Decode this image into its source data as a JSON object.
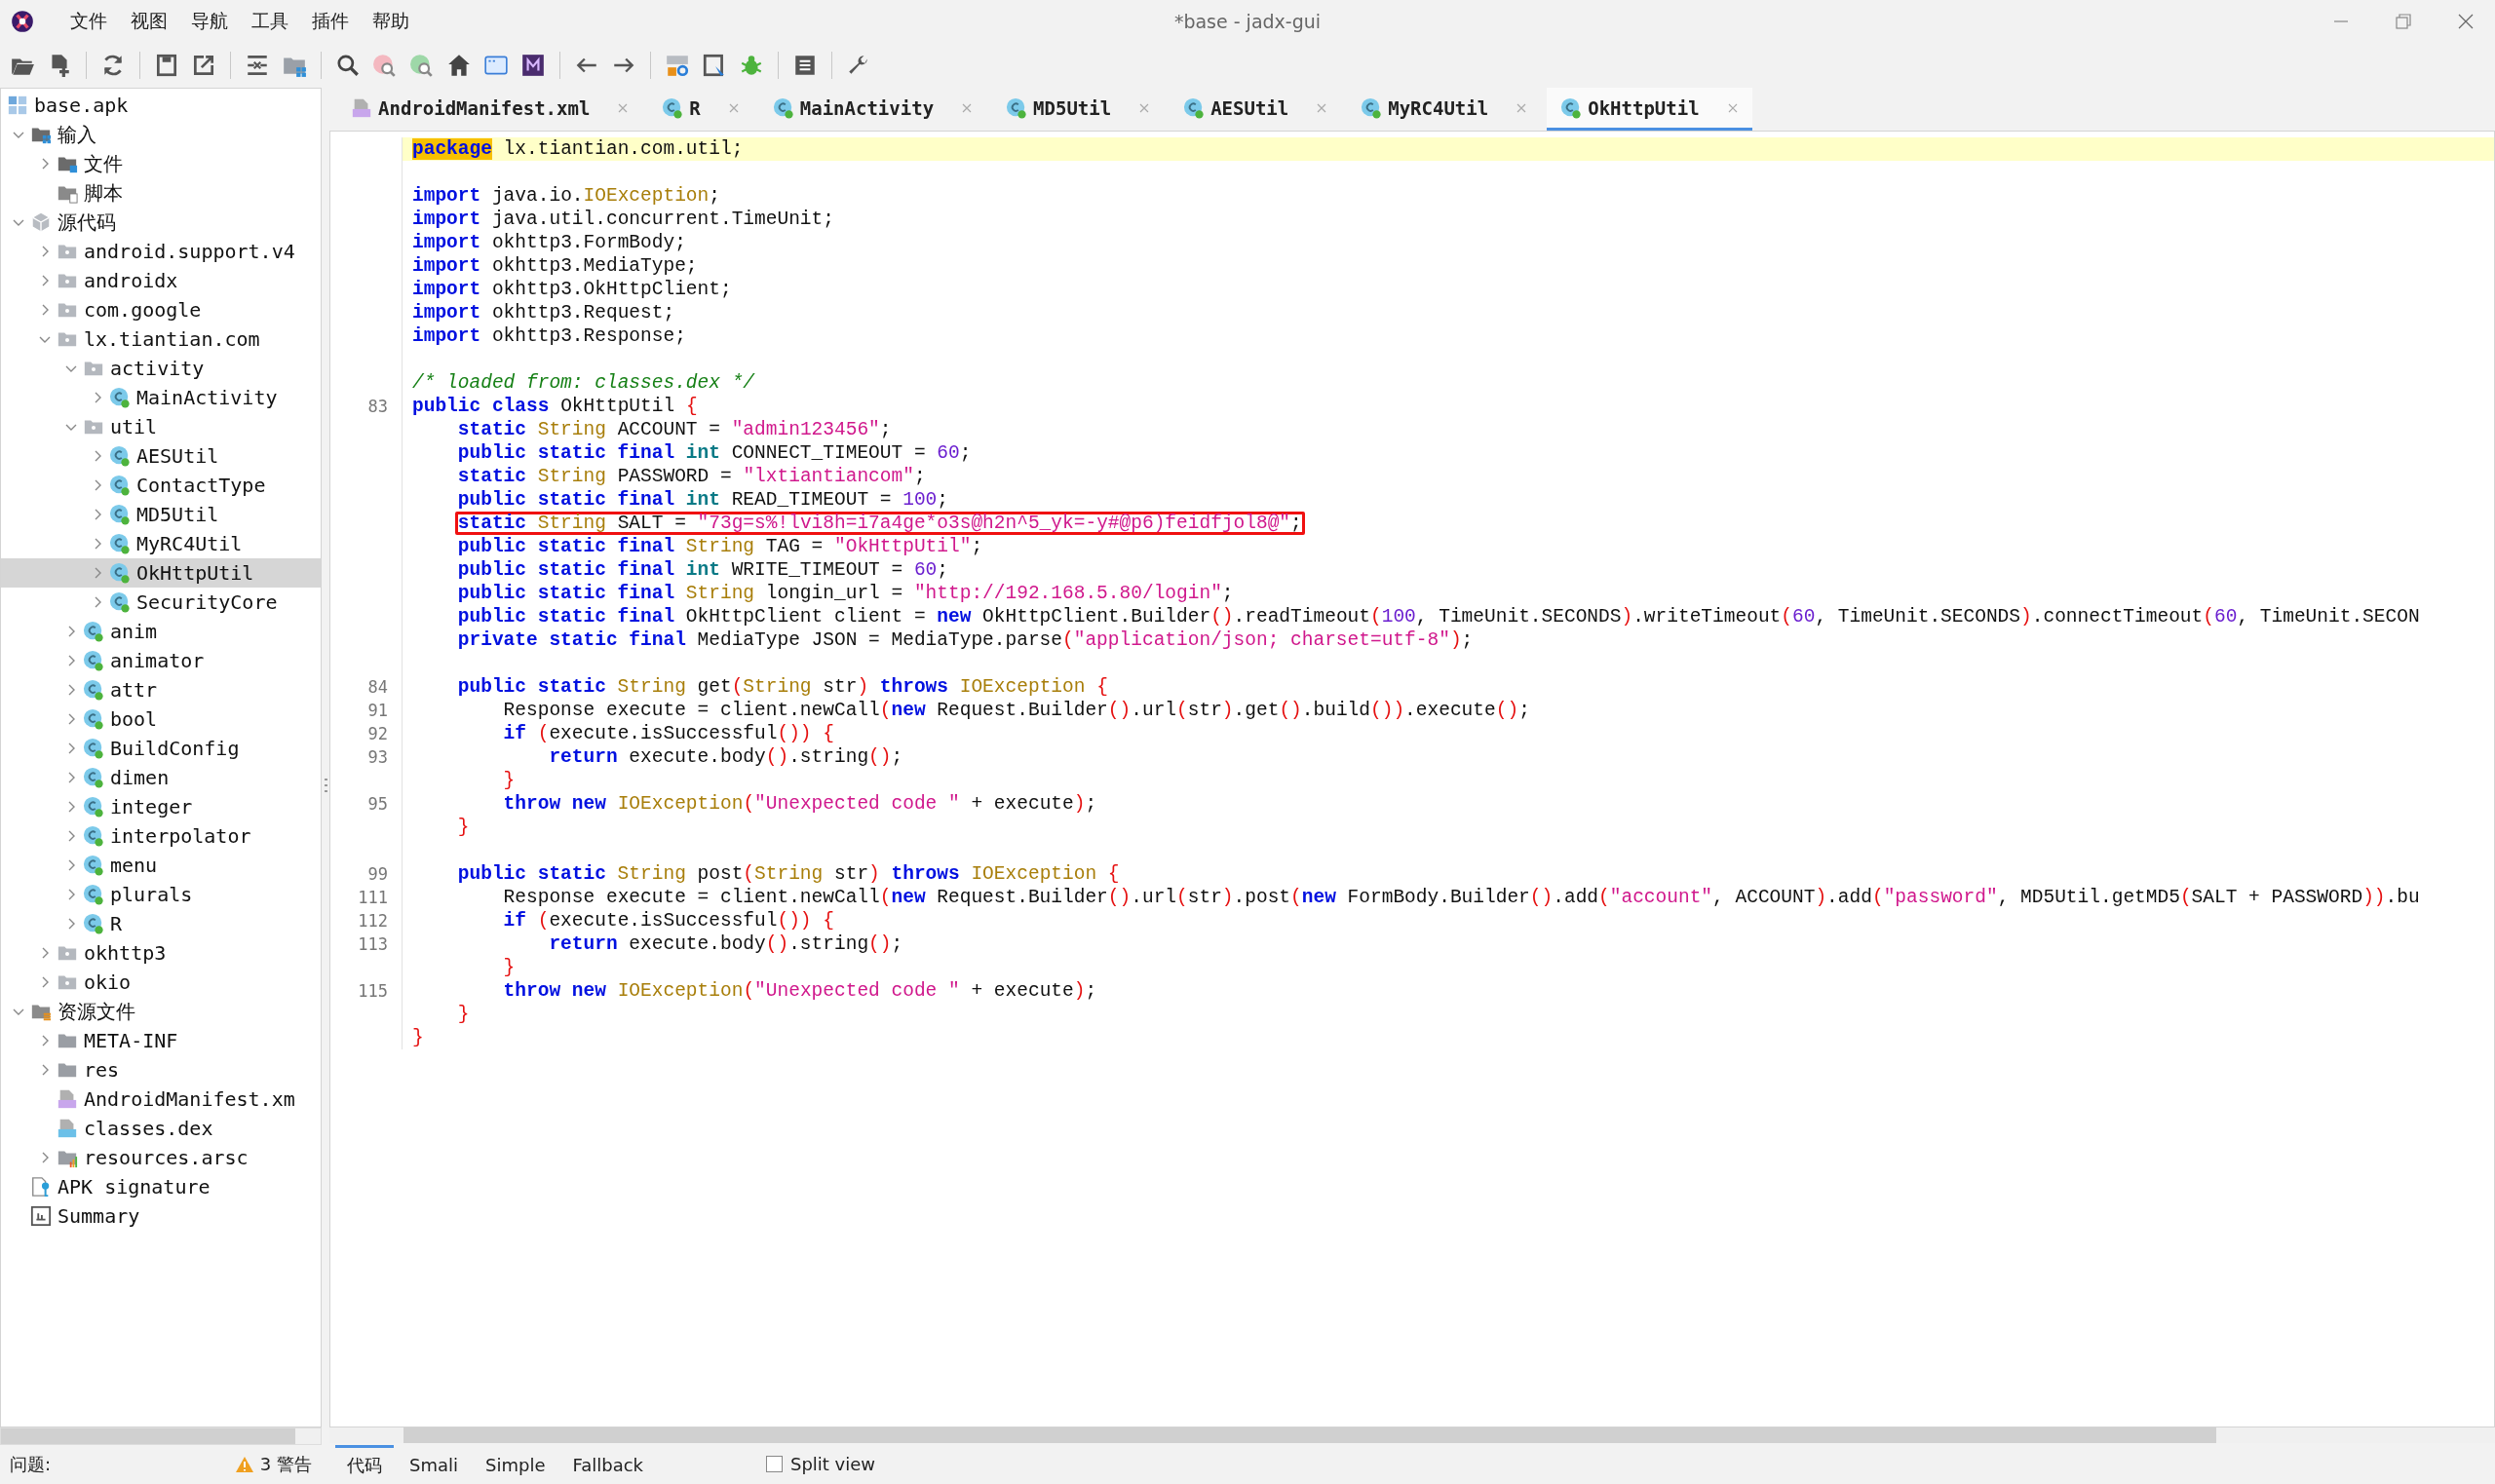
{
  "window": {
    "title": "*base - jadx-gui"
  },
  "menu": [
    "文件",
    "视图",
    "导航",
    "工具",
    "插件",
    "帮助"
  ],
  "tree": {
    "label": "base.apk",
    "kind": "apk",
    "selected": false,
    "children": [
      {
        "label": "输入",
        "kind": "input",
        "expanded": true,
        "selected": false,
        "children": [
          {
            "label": "文件",
            "kind": "files",
            "expanded": false,
            "selected": false
          },
          {
            "label": "脚本",
            "kind": "scripts",
            "selected": false
          }
        ]
      },
      {
        "label": "源代码",
        "kind": "source",
        "expanded": true,
        "selected": false,
        "children": [
          {
            "label": "android.support.v4",
            "kind": "package",
            "expanded": false,
            "selected": false
          },
          {
            "label": "androidx",
            "kind": "package",
            "expanded": false,
            "selected": false
          },
          {
            "label": "com.google",
            "kind": "package",
            "expanded": false,
            "selected": false
          },
          {
            "label": "lx.tiantian.com",
            "kind": "package",
            "expanded": true,
            "selected": false,
            "children": [
              {
                "label": "activity",
                "kind": "package",
                "expanded": true,
                "selected": false,
                "children": [
                  {
                    "label": "MainActivity",
                    "kind": "class",
                    "expanded": false,
                    "selected": false
                  }
                ]
              },
              {
                "label": "util",
                "kind": "package",
                "expanded": true,
                "selected": false,
                "children": [
                  {
                    "label": "AESUtil",
                    "kind": "class",
                    "expanded": false,
                    "selected": false
                  },
                  {
                    "label": "ContactType",
                    "kind": "class",
                    "expanded": false,
                    "selected": false
                  },
                  {
                    "label": "MD5Util",
                    "kind": "class",
                    "expanded": false,
                    "selected": false
                  },
                  {
                    "label": "MyRC4Util",
                    "kind": "class",
                    "expanded": false,
                    "selected": false
                  },
                  {
                    "label": "OkHttpUtil",
                    "kind": "class",
                    "expanded": false,
                    "selected": true
                  },
                  {
                    "label": "SecurityCore",
                    "kind": "class",
                    "expanded": false,
                    "selected": false
                  }
                ]
              },
              {
                "label": "anim",
                "kind": "class",
                "expanded": false,
                "selected": false
              },
              {
                "label": "animator",
                "kind": "class",
                "expanded": false,
                "selected": false
              },
              {
                "label": "attr",
                "kind": "class",
                "expanded": false,
                "selected": false
              },
              {
                "label": "bool",
                "kind": "class",
                "expanded": false,
                "selected": false
              },
              {
                "label": "BuildConfig",
                "kind": "class",
                "expanded": false,
                "selected": false
              },
              {
                "label": "dimen",
                "kind": "class",
                "expanded": false,
                "selected": false
              },
              {
                "label": "integer",
                "kind": "class",
                "expanded": false,
                "selected": false
              },
              {
                "label": "interpolator",
                "kind": "class",
                "expanded": false,
                "selected": false
              },
              {
                "label": "menu",
                "kind": "class",
                "expanded": false,
                "selected": false
              },
              {
                "label": "plurals",
                "kind": "class",
                "expanded": false,
                "selected": false
              },
              {
                "label": "R",
                "kind": "class",
                "expanded": false,
                "selected": false
              }
            ]
          },
          {
            "label": "okhttp3",
            "kind": "package",
            "expanded": false,
            "selected": false
          },
          {
            "label": "okio",
            "kind": "package",
            "expanded": false,
            "selected": false
          }
        ]
      },
      {
        "label": "资源文件",
        "kind": "resources",
        "expanded": true,
        "selected": false,
        "children": [
          {
            "label": "META-INF",
            "kind": "folder",
            "expanded": false,
            "selected": false
          },
          {
            "label": "res",
            "kind": "folder",
            "expanded": false,
            "selected": false
          },
          {
            "label": "AndroidManifest.xm",
            "kind": "manifest",
            "selected": false
          },
          {
            "label": "classes.dex",
            "kind": "dex",
            "selected": false
          },
          {
            "label": "resources.arsc",
            "kind": "arsc",
            "expanded": false,
            "selected": false
          }
        ]
      },
      {
        "label": "APK signature",
        "kind": "signature",
        "selected": false
      },
      {
        "label": "Summary",
        "kind": "summary",
        "selected": false
      }
    ]
  },
  "tabs": [
    {
      "label": "AndroidManifest.xml",
      "kind": "manifest",
      "selected": false
    },
    {
      "label": "R",
      "kind": "class",
      "selected": false
    },
    {
      "label": "MainActivity",
      "kind": "class",
      "selected": false
    },
    {
      "label": "MD5Util",
      "kind": "class",
      "selected": false
    },
    {
      "label": "AESUtil",
      "kind": "class",
      "selected": false
    },
    {
      "label": "MyRC4Util",
      "kind": "class",
      "selected": false
    },
    {
      "label": "OkHttpUtil",
      "kind": "class",
      "selected": true
    }
  ],
  "code": [
    {
      "kind": "code",
      "current": true,
      "boxed": false,
      "tokens": [
        {
          "kind": "match",
          "text": "package"
        },
        {
          "kind": "plain",
          "text": " lx.tiantian.com.util;"
        }
      ]
    },
    {
      "kind": "blank"
    },
    {
      "kind": "code",
      "current": false,
      "boxed": false,
      "tokens": [
        {
          "kind": "keyword",
          "text": "import"
        },
        {
          "kind": "plain",
          "text": " java.io."
        },
        {
          "kind": "type",
          "text": "IOException"
        },
        {
          "kind": "plain",
          "text": ";"
        }
      ]
    },
    {
      "kind": "code",
      "current": false,
      "boxed": false,
      "tokens": [
        {
          "kind": "keyword",
          "text": "import"
        },
        {
          "kind": "plain",
          "text": " java.util.concurrent.TimeUnit;"
        }
      ]
    },
    {
      "kind": "code",
      "current": false,
      "boxed": false,
      "tokens": [
        {
          "kind": "keyword",
          "text": "import"
        },
        {
          "kind": "plain",
          "text": " okhttp3.FormBody;"
        }
      ]
    },
    {
      "kind": "code",
      "current": false,
      "boxed": false,
      "tokens": [
        {
          "kind": "keyword",
          "text": "import"
        },
        {
          "kind": "plain",
          "text": " okhttp3.MediaType;"
        }
      ]
    },
    {
      "kind": "code",
      "current": false,
      "boxed": false,
      "tokens": [
        {
          "kind": "keyword",
          "text": "import"
        },
        {
          "kind": "plain",
          "text": " okhttp3.OkHttpClient;"
        }
      ]
    },
    {
      "kind": "code",
      "current": false,
      "boxed": false,
      "tokens": [
        {
          "kind": "keyword",
          "text": "import"
        },
        {
          "kind": "plain",
          "text": " okhttp3.Request;"
        }
      ]
    },
    {
      "kind": "code",
      "current": false,
      "boxed": false,
      "tokens": [
        {
          "kind": "keyword",
          "text": "import"
        },
        {
          "kind": "plain",
          "text": " okhttp3.Response;"
        }
      ]
    },
    {
      "kind": "blank"
    },
    {
      "kind": "code",
      "current": false,
      "boxed": false,
      "tokens": [
        {
          "kind": "comment",
          "text": "/* loaded from: classes.dex */"
        }
      ]
    },
    {
      "kind": "code",
      "num": "83",
      "current": false,
      "boxed": false,
      "tokens": [
        {
          "kind": "keyword",
          "text": "public class"
        },
        {
          "kind": "plain",
          "text": " OkHttpUtil "
        },
        {
          "kind": "bracket",
          "text": "{"
        }
      ]
    },
    {
      "kind": "code",
      "current": false,
      "boxed": false,
      "tokens": [
        {
          "kind": "keyword",
          "text": "    static"
        },
        {
          "kind": "type",
          "text": " String"
        },
        {
          "kind": "plain",
          "text": " ACCOUNT = "
        },
        {
          "kind": "string",
          "text": "\"admin123456\""
        },
        {
          "kind": "plain",
          "text": ";"
        }
      ]
    },
    {
      "kind": "code",
      "current": false,
      "boxed": false,
      "tokens": [
        {
          "kind": "keyword",
          "text": "    public static final"
        },
        {
          "kind": "primitive",
          "text": " int"
        },
        {
          "kind": "plain",
          "text": " CONNECT_TIMEOUT = "
        },
        {
          "kind": "number",
          "text": "60"
        },
        {
          "kind": "plain",
          "text": ";"
        }
      ]
    },
    {
      "kind": "code",
      "current": false,
      "boxed": false,
      "tokens": [
        {
          "kind": "keyword",
          "text": "    static"
        },
        {
          "kind": "type",
          "text": " String"
        },
        {
          "kind": "plain",
          "text": " PASSWORD = "
        },
        {
          "kind": "string",
          "text": "\"lxtiantiancom\""
        },
        {
          "kind": "plain",
          "text": ";"
        }
      ]
    },
    {
      "kind": "code",
      "current": false,
      "boxed": false,
      "tokens": [
        {
          "kind": "keyword",
          "text": "    public static final"
        },
        {
          "kind": "primitive",
          "text": " int"
        },
        {
          "kind": "plain",
          "text": " READ_TIMEOUT = "
        },
        {
          "kind": "number",
          "text": "100"
        },
        {
          "kind": "plain",
          "text": ";"
        }
      ]
    },
    {
      "kind": "code",
      "current": false,
      "boxed": true,
      "tokens": [
        {
          "kind": "keyword",
          "text": "    static"
        },
        {
          "kind": "type",
          "text": " String"
        },
        {
          "kind": "plain",
          "text": " SALT = "
        },
        {
          "kind": "string",
          "text": "\"73g=s%!lvi8h=i7a4ge*o3s@h2n^5_yk=-y#@p6)feidfjol8@\""
        },
        {
          "kind": "plain",
          "text": ";"
        }
      ]
    },
    {
      "kind": "code",
      "current": false,
      "boxed": false,
      "tokens": [
        {
          "kind": "keyword",
          "text": "    public static final"
        },
        {
          "kind": "type",
          "text": " String"
        },
        {
          "kind": "plain",
          "text": " TAG = "
        },
        {
          "kind": "string",
          "text": "\"OkHttpUtil\""
        },
        {
          "kind": "plain",
          "text": ";"
        }
      ]
    },
    {
      "kind": "code",
      "current": false,
      "boxed": false,
      "tokens": [
        {
          "kind": "keyword",
          "text": "    public static final"
        },
        {
          "kind": "primitive",
          "text": " int"
        },
        {
          "kind": "plain",
          "text": " WRITE_TIMEOUT = "
        },
        {
          "kind": "number",
          "text": "60"
        },
        {
          "kind": "plain",
          "text": ";"
        }
      ]
    },
    {
      "kind": "code",
      "current": false,
      "boxed": false,
      "tokens": [
        {
          "kind": "keyword",
          "text": "    public static final"
        },
        {
          "kind": "type",
          "text": " String"
        },
        {
          "kind": "plain",
          "text": " longin_url = "
        },
        {
          "kind": "string",
          "text": "\"http://192.168.5.80/login\""
        },
        {
          "kind": "plain",
          "text": ";"
        }
      ]
    },
    {
      "kind": "code",
      "current": false,
      "boxed": false,
      "tokens": [
        {
          "kind": "keyword",
          "text": "    public static final"
        },
        {
          "kind": "plain",
          "text": " OkHttpClient client = "
        },
        {
          "kind": "keyword",
          "text": "new"
        },
        {
          "kind": "plain",
          "text": " OkHttpClient.Builder"
        },
        {
          "kind": "bracket",
          "text": "()"
        },
        {
          "kind": "plain",
          "text": ".readTimeout"
        },
        {
          "kind": "bracket",
          "text": "("
        },
        {
          "kind": "number",
          "text": "100"
        },
        {
          "kind": "plain",
          "text": ", TimeUnit.SECONDS"
        },
        {
          "kind": "bracket",
          "text": ")"
        },
        {
          "kind": "plain",
          "text": ".writeTimeout"
        },
        {
          "kind": "bracket",
          "text": "("
        },
        {
          "kind": "number",
          "text": "60"
        },
        {
          "kind": "plain",
          "text": ", TimeUnit.SECONDS"
        },
        {
          "kind": "bracket",
          "text": ")"
        },
        {
          "kind": "plain",
          "text": ".connectTimeout"
        },
        {
          "kind": "bracket",
          "text": "("
        },
        {
          "kind": "number",
          "text": "60"
        },
        {
          "kind": "plain",
          "text": ", TimeUnit.SECON"
        }
      ]
    },
    {
      "kind": "code",
      "current": false,
      "boxed": false,
      "tokens": [
        {
          "kind": "keyword",
          "text": "    private static final"
        },
        {
          "kind": "plain",
          "text": " MediaType JSON = MediaType.parse"
        },
        {
          "kind": "bracket",
          "text": "("
        },
        {
          "kind": "string",
          "text": "\"application/json; charset=utf-8\""
        },
        {
          "kind": "bracket",
          "text": ")"
        },
        {
          "kind": "plain",
          "text": ";"
        }
      ]
    },
    {
      "kind": "blank"
    },
    {
      "kind": "code",
      "num": "84",
      "current": false,
      "boxed": false,
      "tokens": [
        {
          "kind": "keyword",
          "text": "    public static"
        },
        {
          "kind": "type",
          "text": " String"
        },
        {
          "kind": "plain",
          "text": " get"
        },
        {
          "kind": "bracket",
          "text": "("
        },
        {
          "kind": "type",
          "text": "String"
        },
        {
          "kind": "plain",
          "text": " str"
        },
        {
          "kind": "bracket",
          "text": ")"
        },
        {
          "kind": "keyword",
          "text": " throws"
        },
        {
          "kind": "type",
          "text": " IOException"
        },
        {
          "kind": "bracket",
          "text": " {"
        }
      ]
    },
    {
      "kind": "code",
      "num": "91",
      "current": false,
      "boxed": false,
      "tokens": [
        {
          "kind": "plain",
          "text": "        Response execute = client.newCall"
        },
        {
          "kind": "bracket",
          "text": "("
        },
        {
          "kind": "keyword",
          "text": "new"
        },
        {
          "kind": "plain",
          "text": " Request.Builder"
        },
        {
          "kind": "bracket",
          "text": "()"
        },
        {
          "kind": "plain",
          "text": ".url"
        },
        {
          "kind": "bracket",
          "text": "("
        },
        {
          "kind": "plain",
          "text": "str"
        },
        {
          "kind": "bracket",
          "text": ")"
        },
        {
          "kind": "plain",
          "text": ".get"
        },
        {
          "kind": "bracket",
          "text": "()"
        },
        {
          "kind": "plain",
          "text": ".build"
        },
        {
          "kind": "bracket",
          "text": "())"
        },
        {
          "kind": "plain",
          "text": ".execute"
        },
        {
          "kind": "bracket",
          "text": "()"
        },
        {
          "kind": "plain",
          "text": ";"
        }
      ]
    },
    {
      "kind": "code",
      "num": "92",
      "current": false,
      "boxed": false,
      "tokens": [
        {
          "kind": "keyword",
          "text": "        if"
        },
        {
          "kind": "bracket",
          "text": " ("
        },
        {
          "kind": "plain",
          "text": "execute.isSuccessful"
        },
        {
          "kind": "bracket",
          "text": "()) {"
        }
      ]
    },
    {
      "kind": "code",
      "num": "93",
      "current": false,
      "boxed": false,
      "tokens": [
        {
          "kind": "keyword",
          "text": "            return"
        },
        {
          "kind": "plain",
          "text": " execute.body"
        },
        {
          "kind": "bracket",
          "text": "()"
        },
        {
          "kind": "plain",
          "text": ".string"
        },
        {
          "kind": "bracket",
          "text": "()"
        },
        {
          "kind": "plain",
          "text": ";"
        }
      ]
    },
    {
      "kind": "code",
      "current": false,
      "boxed": false,
      "tokens": [
        {
          "kind": "bracket",
          "text": "        }"
        }
      ]
    },
    {
      "kind": "code",
      "num": "95",
      "current": false,
      "boxed": false,
      "tokens": [
        {
          "kind": "keyword",
          "text": "        throw new"
        },
        {
          "kind": "type",
          "text": " IOException"
        },
        {
          "kind": "bracket",
          "text": "("
        },
        {
          "kind": "string",
          "text": "\"Unexpected code \""
        },
        {
          "kind": "plain",
          "text": " + execute"
        },
        {
          "kind": "bracket",
          "text": ")"
        },
        {
          "kind": "plain",
          "text": ";"
        }
      ]
    },
    {
      "kind": "code",
      "current": false,
      "boxed": false,
      "tokens": [
        {
          "kind": "bracket",
          "text": "    }"
        }
      ]
    },
    {
      "kind": "blank"
    },
    {
      "kind": "code",
      "num": "99",
      "current": false,
      "boxed": false,
      "tokens": [
        {
          "kind": "keyword",
          "text": "    public static"
        },
        {
          "kind": "type",
          "text": " String"
        },
        {
          "kind": "plain",
          "text": " post"
        },
        {
          "kind": "bracket",
          "text": "("
        },
        {
          "kind": "type",
          "text": "String"
        },
        {
          "kind": "plain",
          "text": " str"
        },
        {
          "kind": "bracket",
          "text": ")"
        },
        {
          "kind": "keyword",
          "text": " throws"
        },
        {
          "kind": "type",
          "text": " IOException"
        },
        {
          "kind": "bracket",
          "text": " {"
        }
      ]
    },
    {
      "kind": "code",
      "num": "111",
      "current": false,
      "boxed": false,
      "tokens": [
        {
          "kind": "plain",
          "text": "        Response execute = client.newCall"
        },
        {
          "kind": "bracket",
          "text": "("
        },
        {
          "kind": "keyword",
          "text": "new"
        },
        {
          "kind": "plain",
          "text": " Request.Builder"
        },
        {
          "kind": "bracket",
          "text": "()"
        },
        {
          "kind": "plain",
          "text": ".url"
        },
        {
          "kind": "bracket",
          "text": "("
        },
        {
          "kind": "plain",
          "text": "str"
        },
        {
          "kind": "bracket",
          "text": ")"
        },
        {
          "kind": "plain",
          "text": ".post"
        },
        {
          "kind": "bracket",
          "text": "("
        },
        {
          "kind": "keyword",
          "text": "new"
        },
        {
          "kind": "plain",
          "text": " FormBody.Builder"
        },
        {
          "kind": "bracket",
          "text": "()"
        },
        {
          "kind": "plain",
          "text": ".add"
        },
        {
          "kind": "bracket",
          "text": "("
        },
        {
          "kind": "string",
          "text": "\"account\""
        },
        {
          "kind": "plain",
          "text": ", ACCOUNT"
        },
        {
          "kind": "bracket",
          "text": ")"
        },
        {
          "kind": "plain",
          "text": ".add"
        },
        {
          "kind": "bracket",
          "text": "("
        },
        {
          "kind": "string",
          "text": "\"password\""
        },
        {
          "kind": "plain",
          "text": ", MD5Util.getMD5"
        },
        {
          "kind": "bracket",
          "text": "("
        },
        {
          "kind": "plain",
          "text": "SALT + PASSWORD"
        },
        {
          "kind": "bracket",
          "text": "))"
        },
        {
          "kind": "plain",
          "text": ".bu"
        }
      ]
    },
    {
      "kind": "code",
      "num": "112",
      "current": false,
      "boxed": false,
      "tokens": [
        {
          "kind": "keyword",
          "text": "        if"
        },
        {
          "kind": "bracket",
          "text": " ("
        },
        {
          "kind": "plain",
          "text": "execute.isSuccessful"
        },
        {
          "kind": "bracket",
          "text": "()) {"
        }
      ]
    },
    {
      "kind": "code",
      "num": "113",
      "current": false,
      "boxed": false,
      "tokens": [
        {
          "kind": "keyword",
          "text": "            return"
        },
        {
          "kind": "plain",
          "text": " execute.body"
        },
        {
          "kind": "bracket",
          "text": "()"
        },
        {
          "kind": "plain",
          "text": ".string"
        },
        {
          "kind": "bracket",
          "text": "()"
        },
        {
          "kind": "plain",
          "text": ";"
        }
      ]
    },
    {
      "kind": "code",
      "current": false,
      "boxed": false,
      "tokens": [
        {
          "kind": "bracket",
          "text": "        }"
        }
      ]
    },
    {
      "kind": "code",
      "num": "115",
      "current": false,
      "boxed": false,
      "tokens": [
        {
          "kind": "keyword",
          "text": "        throw new"
        },
        {
          "kind": "type",
          "text": " IOException"
        },
        {
          "kind": "bracket",
          "text": "("
        },
        {
          "kind": "string",
          "text": "\"Unexpected code \""
        },
        {
          "kind": "plain",
          "text": " + execute"
        },
        {
          "kind": "bracket",
          "text": ")"
        },
        {
          "kind": "plain",
          "text": ";"
        }
      ]
    },
    {
      "kind": "code",
      "current": false,
      "boxed": false,
      "tokens": [
        {
          "kind": "bracket",
          "text": "    }"
        }
      ]
    },
    {
      "kind": "code",
      "current": false,
      "boxed": false,
      "tokens": [
        {
          "kind": "bracket",
          "text": "}"
        }
      ]
    }
  ],
  "view_tabs": [
    {
      "label": "代码",
      "selected": true
    },
    {
      "label": "Smali",
      "selected": false
    },
    {
      "label": "Simple",
      "selected": false
    },
    {
      "label": "Fallback",
      "selected": false
    }
  ],
  "split_view": {
    "label": "Split view",
    "checked": false
  },
  "status": {
    "label": "问题:",
    "warnings": "3 警告"
  }
}
